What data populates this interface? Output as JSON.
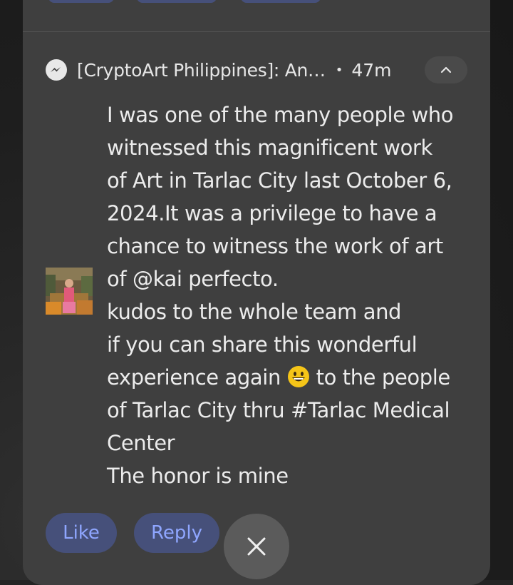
{
  "notification": {
    "app_icon": "messenger-icon",
    "title": "[CryptoArt Philippines]: An…",
    "separator": "•",
    "time": "47m",
    "collapse_icon": "chevron-up-icon",
    "message_lines": [
      "I was one of the many people who",
      "witnessed this magnificent work",
      "of Art in Tarlac City last October 6,",
      "2024.It was a privilege to have a",
      "chance to witness the work of art",
      "of @kai perfecto.",
      "kudos to the whole team and",
      "if you can share this wonderful",
      "experience again",
      "to the people",
      "of Tarlac City thru #Tarlac Medical",
      "Center",
      "The honor is mine"
    ],
    "emoji": "grinning-face-emoji",
    "actions": {
      "like_label": "Like",
      "reply_label": "Reply"
    }
  },
  "close_button": {
    "icon": "close-icon"
  },
  "colors": {
    "card_bg": "#3f3f3f",
    "page_bg": "#1e1e1e",
    "action_bg": "#46507a",
    "action_text": "#8fa6ff",
    "fab_bg": "#5b5b5b"
  }
}
